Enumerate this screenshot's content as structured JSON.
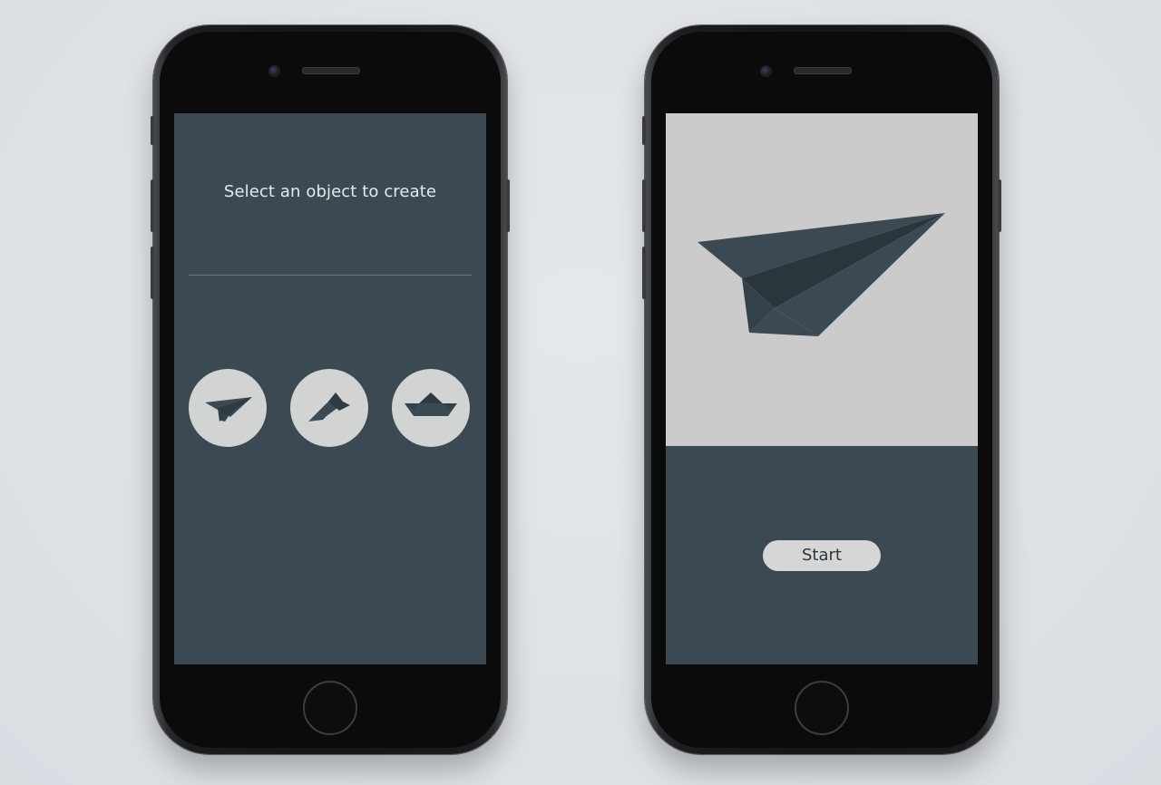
{
  "colors": {
    "background": "#dee2e7",
    "screen_dark": "#3b4a52",
    "preview_bg": "#cbcbcb",
    "circle_bg": "#d2d3d3",
    "icon_fill": "#3b4a52",
    "title_text": "#e6e9eb"
  },
  "select_screen": {
    "title": "Select an object to create",
    "options": [
      {
        "icon": "paper-plane-icon"
      },
      {
        "icon": "paper-glider-icon"
      },
      {
        "icon": "paper-boat-icon"
      }
    ]
  },
  "preview_screen": {
    "preview_icon": "paper-plane-icon",
    "start_label": "Start"
  }
}
